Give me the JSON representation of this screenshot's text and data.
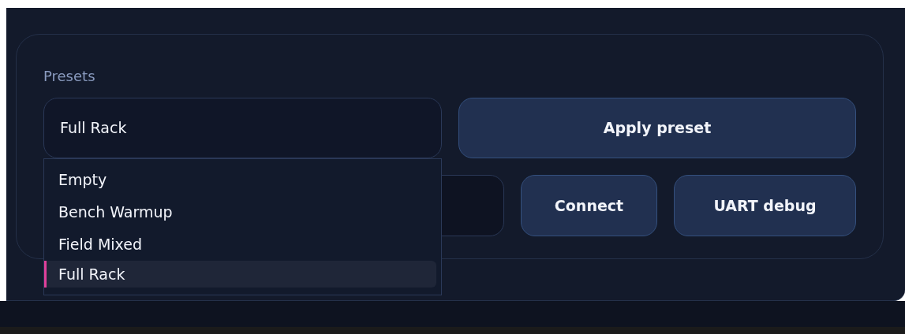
{
  "presets": {
    "label": "Presets",
    "select": {
      "value": "Full Rack",
      "expanded": true,
      "options": [
        {
          "label": "Empty",
          "selected": false
        },
        {
          "label": "Bench Warmup",
          "selected": false
        },
        {
          "label": "Field Mixed",
          "selected": false
        },
        {
          "label": "Full Rack",
          "selected": true
        }
      ]
    },
    "apply_button": "Apply preset"
  },
  "connection": {
    "buttons": [
      "Connect",
      "UART debug"
    ]
  }
}
